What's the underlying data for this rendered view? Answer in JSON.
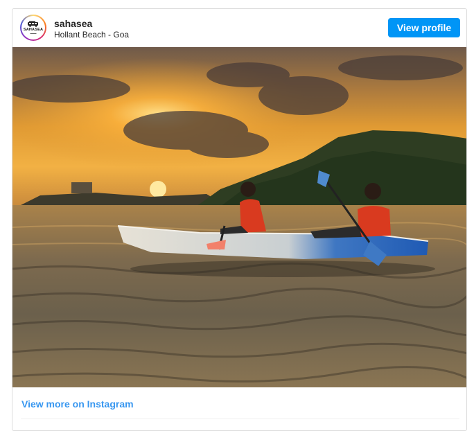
{
  "post": {
    "username": "sahasea",
    "location": "Hollant Beach - Goa",
    "view_profile_label": "View profile",
    "view_more_label": "View more on Instagram"
  },
  "avatar": {
    "brand_text": "SAHASEA",
    "icon": "van-logo"
  },
  "photo": {
    "subject": "two kayakers at sunset"
  },
  "colors": {
    "button_blue": "#0095f6",
    "link_blue": "#3897f0",
    "border": "#dbdbdb"
  }
}
